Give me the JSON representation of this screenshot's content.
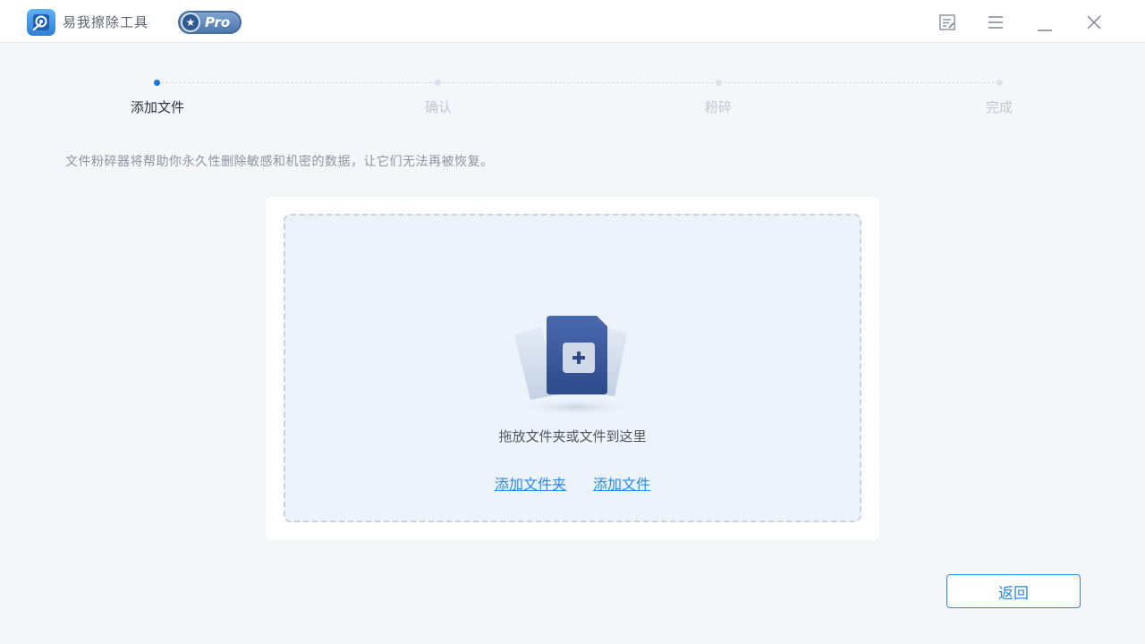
{
  "app": {
    "title": "易我擦除工具",
    "badge": "Pro"
  },
  "window_controls": {
    "feedback": "feedback-icon",
    "menu": "menu-icon",
    "minimize": "minimize-icon",
    "close": "close-icon"
  },
  "stepper": {
    "steps": [
      {
        "label": "添加文件",
        "active": true
      },
      {
        "label": "确认",
        "active": false
      },
      {
        "label": "粉碎",
        "active": false
      },
      {
        "label": "完成",
        "active": false
      }
    ]
  },
  "description": "文件粉碎器将帮助你永久性删除敏感和机密的数据，让它们无法再被恢复。",
  "dropzone": {
    "hint": "拖放文件夹或文件到这里",
    "add_folder": "添加文件夹",
    "add_file": "添加文件"
  },
  "footer": {
    "back_label": "返回"
  },
  "colors": {
    "accent": "#2a87e0",
    "active_dot": "#1677e6",
    "background": "#f4f6fa"
  }
}
